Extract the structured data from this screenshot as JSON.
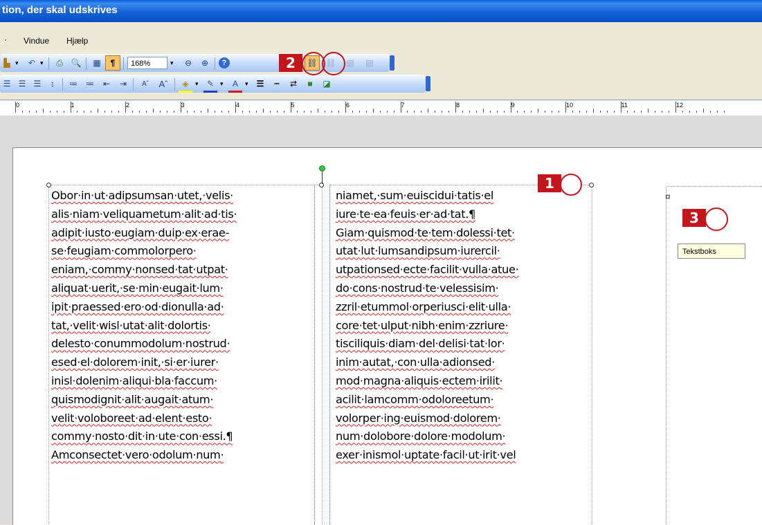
{
  "window": {
    "title": "tion, der skal udskrives"
  },
  "menu": [
    {
      "label": "Vindue"
    },
    {
      "label": "Hjælp"
    }
  ],
  "toolbar": {
    "zoom_value": "168%",
    "icons": [
      "paragraph-mark-icon",
      "zoom-out-icon",
      "zoom-in-icon",
      "help-icon",
      "create-textbox-link-icon",
      "break-link-icon",
      "prev-textbox-icon",
      "next-textbox-icon"
    ]
  },
  "ruler": {
    "numbers": [
      "0",
      "1",
      "2",
      "3",
      "4",
      "5",
      "6",
      "7",
      "8",
      "9",
      "10",
      "11",
      "12"
    ]
  },
  "document": {
    "column1": [
      "Obor·in·ut·adipsumsan·utet,·velis·",
      "alis·niam·veliquametum·alit·ad·tis·",
      "adipit·iusto·eugiam·duip·ex·erae-",
      "se·feugiam·commolorpero·",
      "eniam,·commy·nonsed·tat·utpat·",
      "aliquat·uerit,·se·min·eugait·lum·",
      "ipit·praessed·ero·od·dionulla·ad·",
      "tat,·velit·wisl·utat·alit·dolortis·",
      "delesto·conummodolum·nostrud·",
      "esed·el·dolorem·init,·si·er·iurer·",
      "inisl·dolenim·aliqui·bla·faccum·",
      "quismodignit·alit·augait·atum·",
      "velit·voloboreet·ad·elent·esto·",
      "commy·nosto·dit·in·ute·con·essi.¶",
      "Amconsectet·vero·odolum·num·"
    ],
    "column2": [
      "niamet,·sum·euiscidui·tatis·el",
      "iure·te·ea·feuis·er·ad·tat.¶",
      "Giam·quismod·te·tem·dolessi·tet·",
      "utat·lut·lumsandipsum·iurercil·",
      "utpationsed·ecte·facilit·vulla·atue·",
      "do·cons·nostrud·te·velessisim·",
      "zzril·etummol·orperiusci·elit·ulla·",
      "core·tet·ulput·nibh·enim·zzriure·",
      "tisciliquis·diam·del·delisi·tat·lor·",
      "inim·autat,·con·ulla·adionsed·",
      "mod·magna·aliquis·ectem·irilit·",
      "acilit·lamcomm·odoloreetum·",
      "volorper·ing·euismod·dolorem·",
      "num·dolobore·dolore·modolum·",
      "exer·inismol·uptate·facil·ut·irit·vel"
    ],
    "page2_marker": "¤"
  },
  "callouts": [
    {
      "number": "1"
    },
    {
      "number": "2"
    },
    {
      "number": "3"
    }
  ],
  "tooltip": {
    "text": "Tekstboks"
  },
  "colors": {
    "callout_red": "#c4151c",
    "titlebar_blue": "#0b4fc4",
    "spell_underline": "#d42020"
  }
}
